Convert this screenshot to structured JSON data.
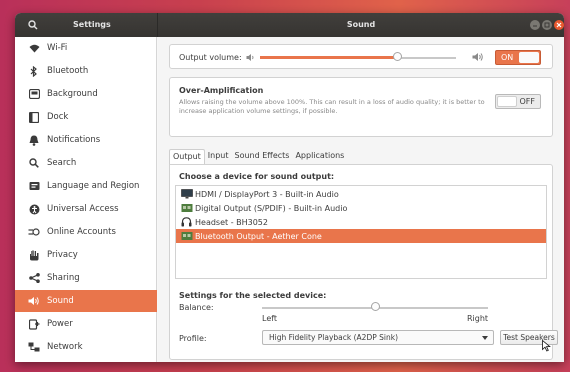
{
  "window": {
    "sidebar_title": "Settings",
    "panel_title": "Sound"
  },
  "icons": {
    "search": "search-icon",
    "minimize": "minimize-icon",
    "maximize": "maximize-icon",
    "close": "close-icon"
  },
  "colors": {
    "accent": "#e9754b",
    "titlebar": "#3a3835",
    "close_button": "#e9592f"
  },
  "sidebar": {
    "items": [
      {
        "label": "Wi-Fi",
        "icon": "wifi-icon"
      },
      {
        "label": "Bluetooth",
        "icon": "bluetooth-icon"
      },
      {
        "label": "Background",
        "icon": "background-icon"
      },
      {
        "label": "Dock",
        "icon": "dock-icon"
      },
      {
        "label": "Notifications",
        "icon": "bell-icon"
      },
      {
        "label": "Search",
        "icon": "search-icon"
      },
      {
        "label": "Language and Region",
        "icon": "language-icon"
      },
      {
        "label": "Universal Access",
        "icon": "universal-access-icon"
      },
      {
        "label": "Online Accounts",
        "icon": "online-accounts-icon"
      },
      {
        "label": "Privacy",
        "icon": "privacy-icon"
      },
      {
        "label": "Sharing",
        "icon": "share-icon"
      },
      {
        "label": "Sound",
        "icon": "speaker-icon",
        "active": true
      },
      {
        "label": "Power",
        "icon": "power-icon"
      },
      {
        "label": "Network",
        "icon": "network-icon"
      }
    ]
  },
  "output_volume": {
    "label": "Output volume:",
    "level_percent": 70,
    "switch_label": "ON"
  },
  "over_amplification": {
    "title": "Over-Amplification",
    "description_line1": "Allows raising the volume above 100%. This can result in a loss of audio quality; it is better to",
    "description_line2": "increase application volume settings, if possible.",
    "switch_label": "OFF"
  },
  "tabs": [
    {
      "label": "Output",
      "active": true
    },
    {
      "label": "Input"
    },
    {
      "label": "Sound Effects"
    },
    {
      "label": "Applications"
    }
  ],
  "device_section": {
    "heading": "Choose a device for sound output:",
    "devices": [
      {
        "label": "HDMI / DisplayPort 3 - Built-in Audio",
        "icon": "monitor-icon"
      },
      {
        "label": "Digital Output (S/PDIF) - Built-in Audio",
        "icon": "audio-card-icon"
      },
      {
        "label": "Headset - BH3052",
        "icon": "headset-icon"
      },
      {
        "label": "Bluetooth Output - Aether Cone",
        "icon": "bluetooth-speaker-icon",
        "selected": true
      }
    ]
  },
  "selected_device": {
    "heading": "Settings for the selected device:",
    "balance_label": "Balance:",
    "balance_position_percent": 50,
    "left_label": "Left",
    "right_label": "Right",
    "profile_label": "Profile:",
    "profile_value": "High Fidelity Playback (A2DP Sink)",
    "test_button": "Test Speakers"
  }
}
